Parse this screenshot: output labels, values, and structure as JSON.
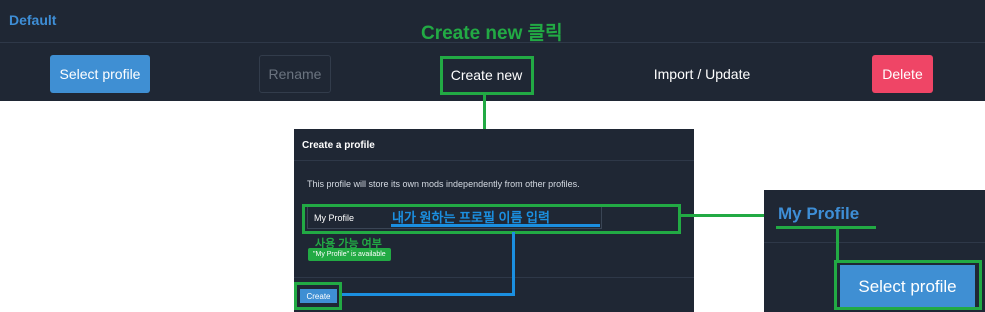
{
  "header": {
    "profile_name": "Default"
  },
  "toolbar": {
    "select_label": "Select profile",
    "rename_label": "Rename",
    "create_label": "Create new",
    "import_label": "Import / Update",
    "delete_label": "Delete"
  },
  "annotations": {
    "create_click": "Create new 클릭",
    "enter_name": "내가 원하는 프로필 이름 입력",
    "availability": "사용 가능 여부"
  },
  "dialog": {
    "title": "Create a profile",
    "description": "This profile will store its own mods independently from other profiles.",
    "input_value": "My Profile",
    "available_badge": "\"My Profile\" is available",
    "create_label": "Create"
  },
  "result_panel": {
    "profile_name": "My Profile",
    "select_label": "Select profile"
  },
  "colors": {
    "panel_bg": "#1f2734",
    "accent_blue": "#3f8fd3",
    "delete_red": "#ef4566",
    "annotation_green": "#22aa44",
    "annotation_blue": "#1b8fe0"
  }
}
